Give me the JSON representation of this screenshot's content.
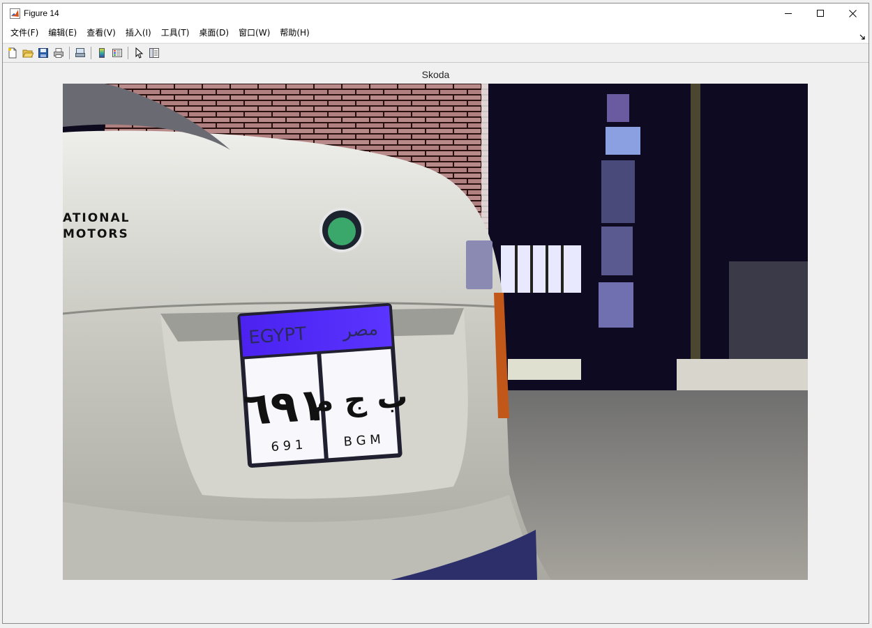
{
  "window": {
    "title": "Figure 14"
  },
  "menu": {
    "items": [
      {
        "label": "文件(F)",
        "name": "menu-file"
      },
      {
        "label": "编辑(E)",
        "name": "menu-edit"
      },
      {
        "label": "查看(V)",
        "name": "menu-view"
      },
      {
        "label": "插入(I)",
        "name": "menu-insert"
      },
      {
        "label": "工具(T)",
        "name": "menu-tools"
      },
      {
        "label": "桌面(D)",
        "name": "menu-desktop"
      },
      {
        "label": "窗口(W)",
        "name": "menu-window"
      },
      {
        "label": "帮助(H)",
        "name": "menu-help"
      }
    ]
  },
  "toolbar": {
    "icons": [
      "new-figure-icon",
      "open-file-icon",
      "save-icon",
      "print-icon",
      "print-preview-icon",
      "colorbar-icon",
      "legend-icon",
      "edit-plot-pointer-icon",
      "property-inspector-icon"
    ]
  },
  "figure": {
    "title": "Skoda",
    "image": {
      "car_text_line1": "ATIONAL",
      "car_text_line2": "MOTORS",
      "plate_country": "EGYPT",
      "plate_country_ar": "مصر",
      "plate_number_ar": "٦٩١",
      "plate_letters_ar": "ب ج م",
      "plate_number_latin": "6 9 1",
      "plate_letters_latin": "B G M"
    }
  }
}
